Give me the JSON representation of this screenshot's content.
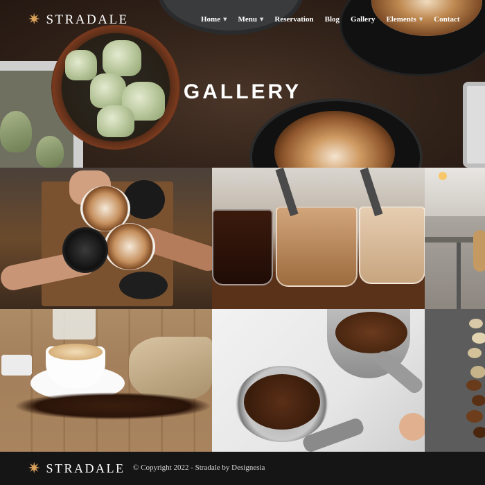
{
  "brand": {
    "name": "STRADALE",
    "icon": "star-icon",
    "accent": "#d9a15a"
  },
  "nav": {
    "items": [
      {
        "label": "Home",
        "has_dropdown": true
      },
      {
        "label": "Menu",
        "has_dropdown": true
      },
      {
        "label": "Reservation",
        "has_dropdown": false
      },
      {
        "label": "Blog",
        "has_dropdown": false
      },
      {
        "label": "Gallery",
        "has_dropdown": false
      },
      {
        "label": "Elements",
        "has_dropdown": true
      },
      {
        "label": "Contact",
        "has_dropdown": false
      }
    ]
  },
  "hero": {
    "title": "GALLERY"
  },
  "gallery": {
    "images": [
      {
        "subject": "hands toasting latte cups"
      },
      {
        "subject": "three glasses of coffee with straws"
      },
      {
        "subject": "cafe interior"
      },
      {
        "subject": "cup of coffee with coffee bean sack"
      },
      {
        "subject": "portafilter with coffee beans and grounds"
      },
      {
        "subject": "coffee beans on dark surface"
      }
    ]
  },
  "footer": {
    "brand": "STRADALE",
    "copyright": "© Copyright 2022 - Stradale by Designesia"
  }
}
